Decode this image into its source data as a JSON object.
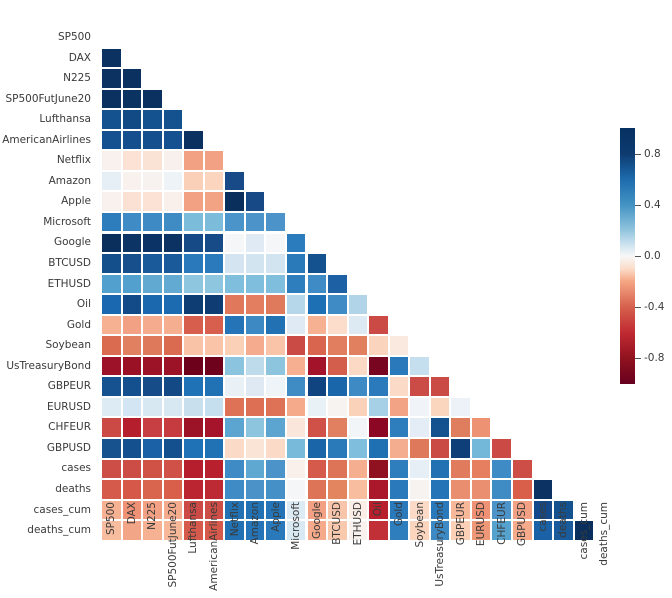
{
  "chart_data": {
    "type": "heatmap",
    "title": "",
    "xlabel": "",
    "ylabel": "",
    "mask": "lower-triangle-excluding-diagonal",
    "colormap": "RdBu",
    "colorbar": {
      "position": "right",
      "vmin": -1.0,
      "vmax": 1.0,
      "ticks": [
        0.8,
        0.4,
        0.0,
        -0.4,
        -0.8
      ],
      "tick_labels": [
        "0.8",
        "0.4",
        "0.0",
        "-0.4",
        "-0.8"
      ]
    },
    "categories": [
      "SP500",
      "DAX",
      "N225",
      "SP500FutJune20",
      "Lufthansa",
      "AmericanAirlines",
      "Netflix",
      "Amazon",
      "Apple",
      "Microsoft",
      "Google",
      "BTCUSD",
      "ETHUSD",
      "Oil",
      "Gold",
      "Soybean",
      "UsTreasuryBond",
      "GBPEUR",
      "EURUSD",
      "CHFEUR",
      "GBPUSD",
      "cases",
      "deaths",
      "cases_cum",
      "deaths_cum"
    ],
    "row_labels": [
      "SP500",
      "DAX",
      "N225",
      "SP500FutJune20",
      "Lufthansa",
      "AmericanAirlines",
      "Netflix",
      "Amazon",
      "Apple",
      "Microsoft",
      "Google",
      "BTCUSD",
      "ETHUSD",
      "Oil",
      "Gold",
      "Soybean",
      "UsTreasuryBond",
      "GBPEUR",
      "EURUSD",
      "CHFEUR",
      "GBPUSD",
      "cases",
      "deaths",
      "cases_cum",
      "deaths_cum"
    ],
    "col_labels": [
      "SP500",
      "DAX",
      "N225",
      "SP500FutJune20",
      "Lufthansa",
      "AmericanAirlines",
      "Netflix",
      "Amazon",
      "Apple",
      "Microsoft",
      "Google",
      "BTCUSD",
      "ETHUSD",
      "Oil",
      "Gold",
      "Soybean",
      "UsTreasuryBond",
      "GBPEUR",
      "EURUSD",
      "CHFEUR",
      "GBPUSD",
      "cases",
      "deaths",
      "cases_cum",
      "deaths_cum"
    ],
    "values": [
      [],
      [
        0.92
      ],
      [
        0.93,
        0.93
      ],
      [
        0.94,
        0.92,
        0.94
      ],
      [
        0.8,
        0.82,
        0.8,
        0.8
      ],
      [
        0.78,
        0.79,
        0.79,
        0.78,
        0.93
      ],
      [
        -0.04,
        -0.13,
        -0.12,
        -0.05,
        -0.4,
        null
      ],
      [
        0.1,
        -0.03,
        -0.02,
        0.06,
        -0.3,
        null,
        0.77
      ],
      [
        -0.05,
        -0.14,
        -0.13,
        -0.06,
        -0.41,
        null,
        0.95,
        0.83
      ],
      [
        0.58,
        0.53,
        0.54,
        0.55,
        0.33,
        null,
        0.56,
        0.6,
        0.54
      ],
      [
        0.94,
        0.92,
        0.92,
        0.93,
        0.75,
        null,
        0.02,
        0.15,
        0.01,
        0.62
      ],
      [
        0.73,
        0.73,
        0.72,
        0.72,
        0.67,
        null,
        0.17,
        0.24,
        0.16,
        0.61,
        0.77
      ],
      [
        0.52,
        0.52,
        0.5,
        0.5,
        0.42,
        null,
        0.43,
        0.47,
        0.43,
        0.56,
        0.57,
        0.61
      ],
      [
        0.7,
        0.78,
        0.71,
        0.71,
        0.91,
        null,
        -0.38,
        -0.32,
        -0.39,
        0.28,
        0.66,
        0.54,
        0.3
      ],
      [
        -0.32,
        -0.36,
        -0.34,
        -0.33,
        -0.54,
        null,
        0.62,
        0.5,
        0.62,
        0.13,
        -0.31,
        -0.16,
        0.06,
        -0.53
      ],
      [
        -0.5,
        -0.44,
        -0.46,
        -0.48,
        -0.35,
        null,
        -0.24,
        -0.2,
        -0.24,
        -0.44,
        -0.48,
        -0.44,
        -0.35,
        -0.22,
        -0.04
      ],
      [
        -0.88,
        -0.9,
        -0.89,
        -0.88,
        -0.97,
        null,
        0.44,
        0.34,
        0.45,
        -0.25,
        -0.86,
        -0.66,
        -0.3,
        -0.96,
        0.56,
        0.35
      ],
      [
        0.77,
        0.78,
        0.76,
        0.78,
        0.67,
        null,
        -0.06,
        0.01,
        -0.07,
        0.49,
        0.8,
        0.66,
        0.47,
        0.65,
        -0.17,
        -0.49,
        -0.6
      ],
      [
        0.15,
        0.17,
        0.16,
        0.16,
        0.22,
        null,
        -0.45,
        -0.4,
        -0.45,
        -0.08,
        0.08,
        0.05,
        -0.19,
        0.37,
        -0.46,
        0.09,
        -0.24,
        0.08
      ],
      [
        -0.61,
        -0.66,
        -0.63,
        -0.62,
        -0.8,
        null,
        0.44,
        0.36,
        0.44,
        -0.09,
        -0.58,
        -0.41,
        -0.07,
        -0.87,
        0.61,
        0.06,
        0.81,
        -0.47,
        -0.35
      ],
      [
        0.7,
        0.72,
        0.7,
        0.72,
        0.63,
        null,
        -0.16,
        -0.08,
        -0.16,
        0.42,
        0.73,
        0.6,
        0.4,
        0.68,
        -0.26,
        -0.45,
        -0.64,
        0.94,
        -0.1,
        -0.58
      ],
      [
        -0.55,
        -0.56,
        -0.55,
        -0.54,
        -0.75,
        null,
        0.49,
        0.44,
        0.49,
        -0.03,
        -0.52,
        -0.34,
        -0.18,
        -0.85,
        0.52,
        0.2,
        0.79,
        -0.42,
        -0.38,
        0.73,
        -0.54
      ],
      [
        -0.47,
        -0.5,
        -0.48,
        -0.48,
        -0.7,
        null,
        0.51,
        0.46,
        0.51,
        0.02,
        -0.46,
        -0.3,
        -0.14,
        -0.81,
        0.55,
        0.22,
        0.77,
        -0.38,
        -0.33,
        0.71,
        -0.5,
        0.91
      ],
      [
        -0.34,
        -0.39,
        -0.37,
        -0.35,
        -0.6,
        null,
        0.61,
        0.55,
        0.61,
        0.11,
        -0.33,
        -0.21,
        -0.04,
        -0.74,
        0.62,
        0.26,
        0.72,
        -0.29,
        -0.28,
        0.67,
        -0.42,
        0.82,
        0.85
      ],
      [
        -0.3,
        -0.36,
        -0.34,
        -0.32,
        -0.57,
        null,
        0.62,
        0.57,
        0.62,
        0.14,
        -0.3,
        -0.18,
        -0.02,
        -0.72,
        0.64,
        0.27,
        0.7,
        -0.26,
        -0.26,
        0.65,
        -0.39,
        0.79,
        0.82,
        0.93
      ]
    ],
    "colors": [
      [],
      [
        "#0b3260"
      ],
      [
        "#0b3261",
        "#0a3160"
      ],
      [
        "#0a3160",
        "#0b3362",
        "#0a3160"
      ],
      [
        "#14518f",
        "#124a85",
        "#14518f",
        "#14518f"
      ],
      [
        "#155190",
        "#154f8e",
        "#154f8e",
        "#155190",
        "#0a3160"
      ],
      [
        "#f8f1ee",
        "#fbe2d5",
        "#fae2d5",
        "#f8f0ec",
        "#f2a282",
        "#f2a184"
      ],
      [
        "#e6eef6",
        "#f8f1ee",
        "#f7f2ef",
        "#eef3f7",
        "#fad1b8",
        "#fbd5be",
        "#174a86"
      ],
      [
        "#f9f1ed",
        "#fbe1d3",
        "#fbe2d5",
        "#f9f0eb",
        "#f2a182",
        "#f2a384",
        "#0a2f5c",
        "#164985"
      ],
      [
        "#2d7dbd",
        "#3f8bc5",
        "#3e8ac4",
        "#3f8cc5",
        "#7bbcda",
        "#7cbcda",
        "#4b94c9",
        "#4b93c8",
        "#4b93c8"
      ],
      [
        "#0a2f5c",
        "#0c3464",
        "#0c3365",
        "#0b3263",
        "#164a86",
        "#164b87",
        "#f4f6f7",
        "#dfeaf4",
        "#f4f6f7",
        "#2b7cbc"
      ],
      [
        "#144e8b",
        "#164f8c",
        "#1a5a9a",
        "#1a5a9a",
        "#2a79ba",
        "#2b7abb",
        "#d4e5f1",
        "#d3e4f1",
        "#d3e4f1",
        "#2a79b9",
        "#14518f"
      ],
      [
        "#52a0cd",
        "#52a0cd",
        "#62a9d2",
        "#63aad3",
        "#8ec6e0",
        "#8ec6e0",
        "#7fbedc",
        "#7fbedc",
        "#7fbedc",
        "#2e7ebd",
        "#3e8bc5",
        "#1d61a4"
      ],
      [
        "#1a69b0",
        "#134b89",
        "#1b68ae",
        "#1c6aaf",
        "#0e3d74",
        "#0e3c73",
        "#e0795b",
        "#e37f60",
        "#e07a5c",
        "#b5d7e9",
        "#1e70b4",
        "#3e8bc5",
        "#b1d4e8"
      ],
      [
        "#f6b193",
        "#f2a184",
        "#f5ab8d",
        "#f6ae90",
        "#d75d4c",
        "#d85f4e",
        "#2474b7",
        "#3c89c3",
        "#2171b3",
        "#dfeaf4",
        "#f6b193",
        "#fcdcca",
        "#ddeaf3",
        "#cb4a46"
      ],
      [
        "#da6b51",
        "#e08060",
        "#de7a5b",
        "#da6a50",
        "#f9c3a8",
        "#f9c4a8",
        "#fad0b6",
        "#f5ac8e",
        "#f9c4a8",
        "#ca4a46",
        "#d9654e",
        "#e07e5f",
        "#e0805f",
        "#fbd4bd",
        "#fae9de"
      ],
      [
        "#9d1228",
        "#9a1126",
        "#9c1227",
        "#9c1227",
        "#6d011b",
        "#6e021c",
        "#8ac4df",
        "#bddbeb",
        "#8dc5df",
        "#f6af91",
        "#a3132a",
        "#d35e4c",
        "#fcd9c5",
        "#780620",
        "#2a79ba",
        "#c6dfee"
      ],
      [
        "#16528f",
        "#15508e",
        "#164d89",
        "#134a86",
        "#1f72b5",
        "#2072b5",
        "#e9f1f6",
        "#dee9f3",
        "#eff4f8",
        "#3f8cc5",
        "#0f4480",
        "#1a66ab",
        "#3e8ac4",
        "#2b7abb",
        "#fbdbc7",
        "#cb4b47",
        "#ca4a46"
      ],
      [
        "#dcebf4",
        "#d3e5f2",
        "#d8e8f3",
        "#d8e8f3",
        "#c8e0ee",
        "#c6dfee",
        "#dd7257",
        "#dc6f54",
        "#dd7257",
        "#f4aa8b",
        "#e8f1f6",
        "#f6f3f1",
        "#fad2ba",
        "#a6d0e5",
        "#f3a385",
        "#f0f4f8",
        "#fbd6bf",
        "#ecf2f7"
      ],
      [
        "#cb4a46",
        "#b51e2c",
        "#c73f42",
        "#c53b40",
        "#9c1227",
        "#a5142b",
        "#5ba5d0",
        "#8dc5df",
        "#5ba5d0",
        "#fae6da",
        "#d05147",
        "#e08060",
        "#f2f5f8",
        "#8c0723",
        "#2e7ebd",
        "#e4edf5",
        "#14518f",
        "#df7e5e",
        "#ed9272"
      ],
      [
        "#17528f",
        "#15508e",
        "#1b61a5",
        "#14508d",
        "#1f72b5",
        "#2072b5",
        "#fbdbc7",
        "#fae4d6",
        "#fbdbc7",
        "#77bada",
        "#1a64a8",
        "#2a79b9",
        "#7fbedc",
        "#1f70b3",
        "#f5ad8f",
        "#de7a5b",
        "#ca4a46",
        "#0e3f78",
        "#74b8d9",
        "#cb4a46"
      ],
      [
        "#cd4e47",
        "#cc4c46",
        "#d05247",
        "#cf5147",
        "#b61e2d",
        "#b8202e",
        "#3f8bc5",
        "#5ea8d1",
        "#4b93c8",
        "#f9f0eb",
        "#d65a4b",
        "#dd7458",
        "#f5ae90",
        "#90111f",
        "#2e7ebd",
        "#e6eef6",
        "#2171b3",
        "#e07c5d",
        "#e57f60",
        "#3e8bc5",
        "#cd4e47"
      ],
      [
        "#d65a4b",
        "#d55849",
        "#da654e",
        "#d95f4b",
        "#bb2531",
        "#bd2a33",
        "#3f8bc5",
        "#4a92c8",
        "#4490c7",
        "#f4f6f7",
        "#dd7458",
        "#e3865f",
        "#f8bd9f",
        "#ab172b",
        "#2a79ba",
        "#f7f3f0",
        "#2474b7",
        "#e98e6e",
        "#ea9070",
        "#3f8cc5",
        "#d95f4b",
        "#0b3262"
      ],
      [
        "#f6b193",
        "#ee9174",
        "#f2a184",
        "#f5ac8e",
        "#cb4a46",
        "#cd4e47",
        "#2171b3",
        "#2171b3",
        "#2474b7",
        "#dcebf4",
        "#f2a184",
        "#f9c5aa",
        "#faeee7",
        "#b71f2d",
        "#2a79ba",
        "#fbdbc7",
        "#2a79ba",
        "#f7b89a",
        "#ee9174",
        "#4b93c8",
        "#f2a184",
        "#13498a",
        "#14518f"
      ],
      [
        "#f8bd9f",
        "#f3a587",
        "#f6b193",
        "#f7b89a",
        "#d65a4b",
        "#d65a4b",
        "#2171b3",
        "#2474b7",
        "#2a79ba",
        "#d9e9f4",
        "#f4aa8b",
        "#f9c9ae",
        "#f9f1ed",
        "#c13037",
        "#2e7ebd",
        "#fbd5be",
        "#3c89c3",
        "#fbd0b7",
        "#ef9878",
        "#55a2ce",
        "#f4aa8b",
        "#1b61a5",
        "#1a5b9b",
        "#0a2f5c"
      ]
    ]
  },
  "colorbar": {
    "ticks": [
      "0.8",
      "0.4",
      "0.0",
      "-0.4",
      "-0.8"
    ]
  }
}
